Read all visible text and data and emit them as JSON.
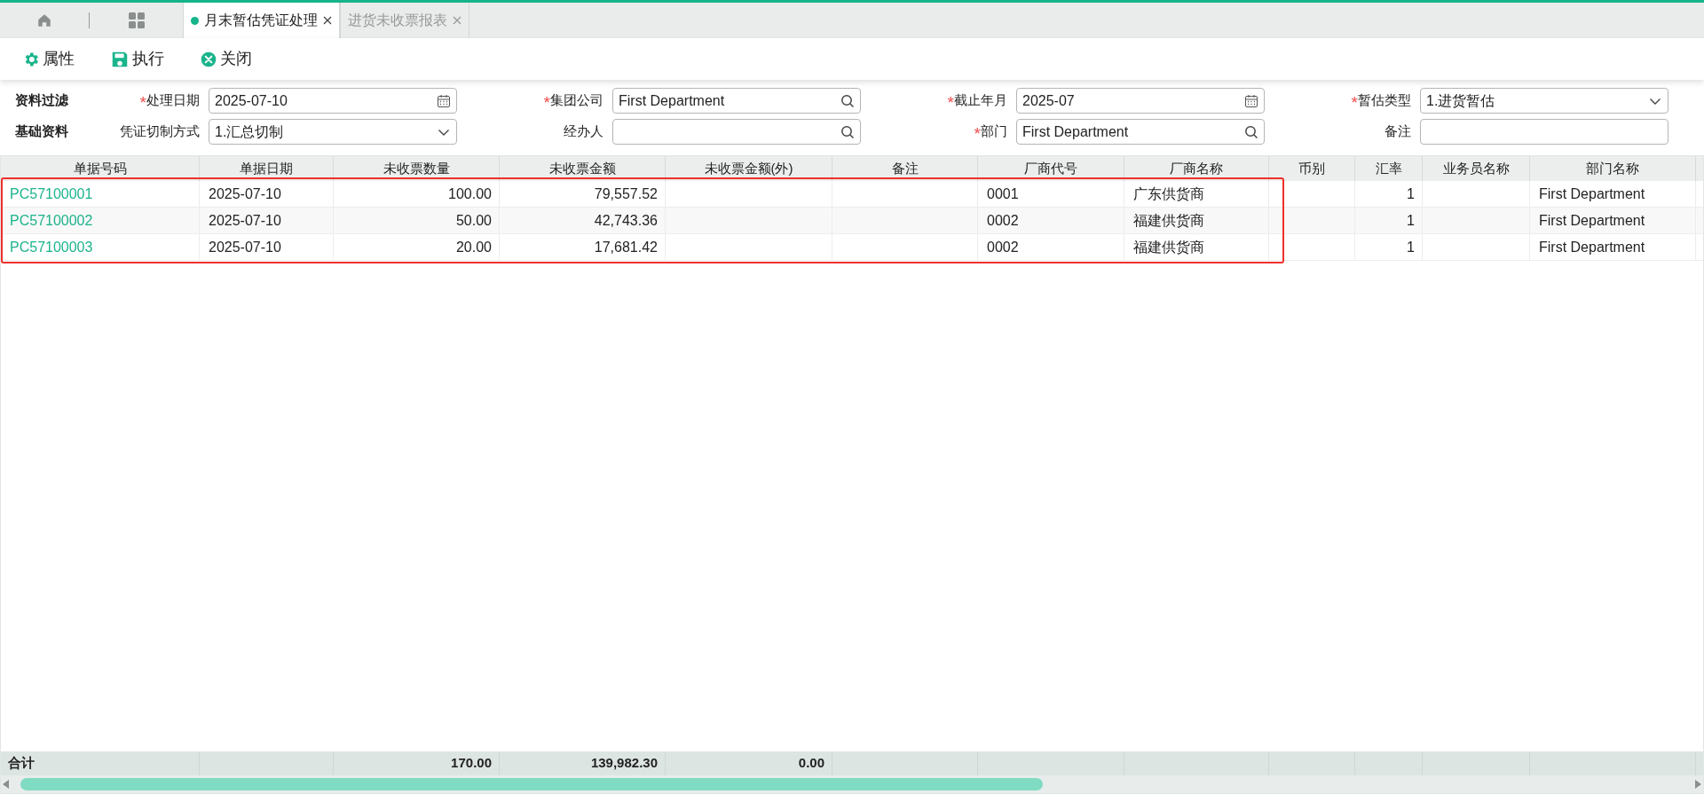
{
  "tabs": [
    {
      "kind": "home",
      "selected": false
    },
    {
      "kind": "apps",
      "selected": false
    },
    {
      "kind": "page",
      "label": "月末暂估凭证处理",
      "selected": true
    },
    {
      "kind": "page",
      "label": "进货未收票报表",
      "selected": false
    }
  ],
  "toolbar": [
    {
      "kind": "settings",
      "label": "属性"
    },
    {
      "kind": "save",
      "label": "执行"
    },
    {
      "kind": "close",
      "label": "关闭"
    }
  ],
  "filter": {
    "sections": [
      "资料过滤",
      "基础资料"
    ],
    "rows": [
      [
        {
          "mark": "*",
          "label": "处理日期",
          "kind": "date",
          "value": "2025-07-10"
        },
        {
          "mark": "*",
          "label": "集团公司",
          "kind": "search",
          "value": "First Department"
        },
        {
          "mark": "*",
          "label": "截止年月",
          "kind": "date",
          "value": "2025-07"
        },
        {
          "mark": "*",
          "label": "暂估类型",
          "kind": "select",
          "value": "1.进货暂估"
        }
      ],
      [
        {
          "label": "凭证切制方式",
          "kind": "select",
          "value": "1.汇总切制"
        },
        {
          "label": "经办人",
          "kind": "search"
        },
        {
          "mark": "*",
          "label": "部门",
          "kind": "search",
          "value": "First Department"
        },
        {
          "label": "备注",
          "kind": "text"
        }
      ]
    ]
  },
  "table": {
    "columns": [
      {
        "label": "单据号码",
        "kind": "link"
      },
      {
        "label": "单据日期",
        "kind": "text"
      },
      {
        "label": "未收票数量",
        "kind": "number"
      },
      {
        "label": "未收票金额",
        "kind": "number"
      },
      {
        "label": "未收票金额(外)",
        "kind": "number"
      },
      {
        "label": "备注",
        "kind": "text"
      },
      {
        "label": "厂商代号",
        "kind": "text"
      },
      {
        "label": "厂商名称",
        "kind": "text"
      },
      {
        "label": "币别",
        "kind": "text"
      },
      {
        "label": "汇率",
        "kind": "number"
      },
      {
        "label": "业务员名称",
        "kind": "text"
      },
      {
        "label": "部门名称",
        "kind": "text"
      }
    ],
    "rows": [
      [
        "PC57100001",
        "2025-07-10",
        "100.00",
        "79,557.52",
        null,
        null,
        "0001",
        "广东供货商",
        null,
        "1",
        null,
        "First Department"
      ],
      [
        "PC57100002",
        "2025-07-10",
        "50.00",
        "42,743.36",
        null,
        null,
        "0002",
        "福建供货商",
        null,
        "1",
        null,
        "First Department"
      ],
      [
        "PC57100003",
        "2025-07-10",
        "20.00",
        "17,681.42",
        null,
        null,
        "0002",
        "福建供货商",
        null,
        "1",
        null,
        "First Department"
      ]
    ],
    "totals": {
      "label": "合计",
      "quantity": "170.00",
      "amount": "139,982.30",
      "amount_foreign": "0.00"
    }
  }
}
